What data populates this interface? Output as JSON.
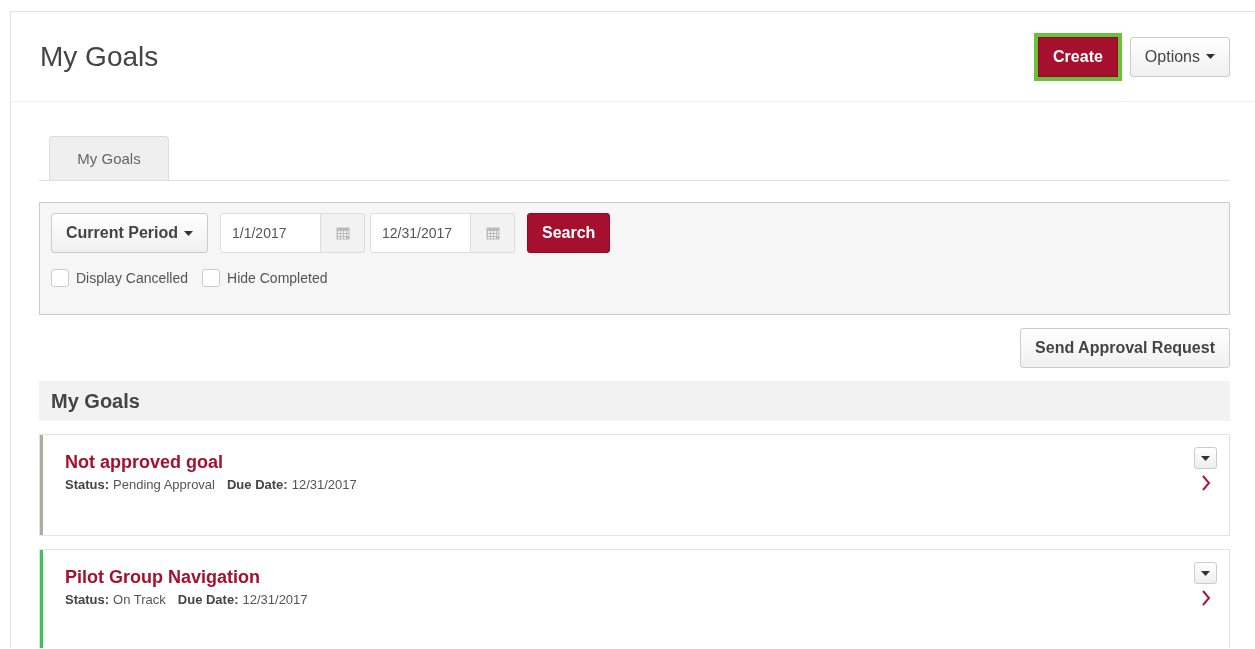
{
  "page": {
    "title": "My Goals",
    "buttons": [
      {
        "label": "Create",
        "kind": "primary",
        "focused": true
      },
      {
        "label": "Options",
        "kind": "dropdown",
        "focused": false
      }
    ]
  },
  "tabs": [
    {
      "label": "My Goals",
      "selected": true
    }
  ],
  "filters": {
    "period": "Current Period",
    "start_date": "1/1/2017",
    "end_date": "12/31/2017",
    "search_button": "Search",
    "checkboxes": [
      {
        "label": "Display Cancelled",
        "checked": false
      },
      {
        "label": "Hide Completed",
        "checked": false
      }
    ]
  },
  "send_button": "Send Approval Request",
  "section_title": "My Goals",
  "goals": [
    {
      "title": "Not approved goal",
      "status_label": "Status:",
      "status": "Pending Approval",
      "due_label": "Due Date:",
      "due": "12/31/2017",
      "color": "#b0ad9f"
    },
    {
      "title": "Pilot Group Navigation",
      "status_label": "Status:",
      "status": "On Track",
      "due_label": "Due Date:",
      "due": "12/31/2017",
      "color": "#3cc35a"
    }
  ]
}
